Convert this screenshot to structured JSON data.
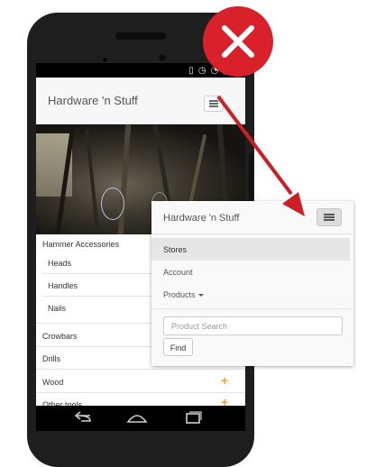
{
  "app": {
    "brand": "Hardware 'n Stuff"
  },
  "menu": {
    "section": "Hammer Accessories",
    "subitems": [
      "Heads",
      "Handles",
      "Nails"
    ],
    "items": [
      "Crowbars",
      "Drills",
      "Wood",
      "Other tools"
    ]
  },
  "popup": {
    "brand": "Hardware 'n Stuff",
    "nav": [
      "Stores",
      "Account",
      "Products"
    ],
    "search_placeholder": "Product Search",
    "find_label": "Find"
  },
  "colors": {
    "red_badge": "#d8212b",
    "arrow": "#cc1f25",
    "plus_accent": "#f0a33a"
  },
  "icons": [
    "close-x-icon",
    "hamburger-menu-icon",
    "back-icon",
    "home-icon",
    "recents-icon",
    "wifi-icon",
    "signal-icon",
    "battery-icon",
    "vibrate-icon"
  ]
}
